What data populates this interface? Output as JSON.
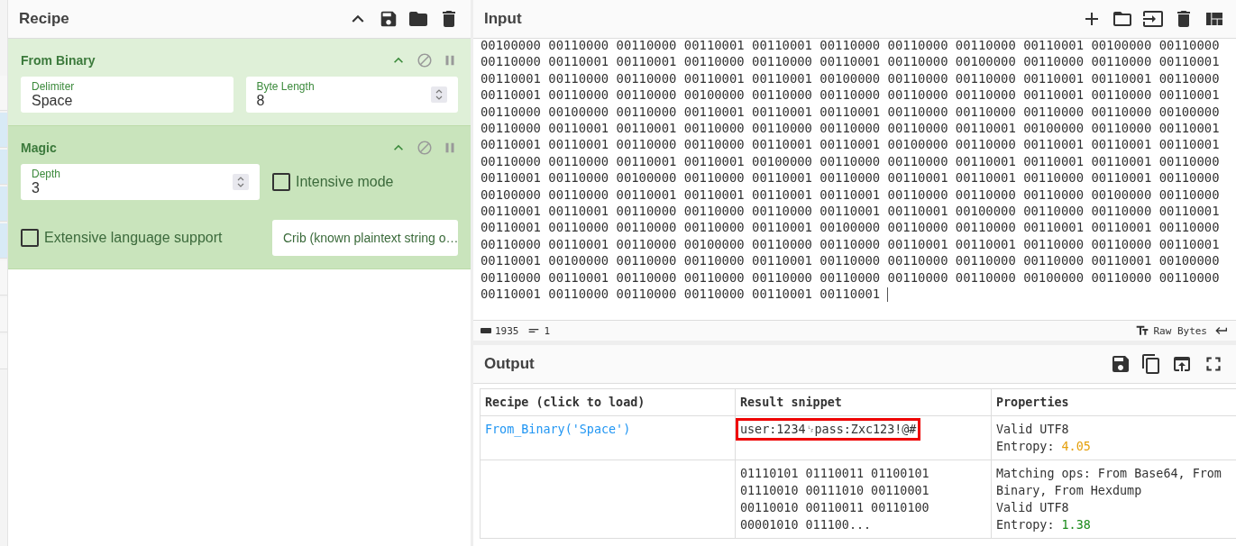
{
  "recipe": {
    "title": "Recipe",
    "operations": [
      {
        "name": "From Binary",
        "kind": "from_binary",
        "fields": [
          {
            "kind": "text",
            "label": "Delimiter",
            "value": "Space"
          },
          {
            "kind": "number",
            "label": "Byte Length",
            "value": "8"
          }
        ]
      },
      {
        "name": "Magic",
        "kind": "magic",
        "fields": [
          {
            "kind": "number",
            "label": "Depth",
            "value": "3"
          },
          {
            "kind": "checkbox",
            "label": "Intensive mode",
            "checked": false
          },
          {
            "kind": "checkbox",
            "label": "Extensive language support",
            "checked": false
          },
          {
            "kind": "text",
            "placeholder": "Crib (known plaintext string o…"
          }
        ]
      }
    ]
  },
  "input": {
    "title": "Input",
    "lines": [
      "00100000 00110000 00110000 00110001 00110001 00110000 00110000 00110000 00110001 00100000 00110000",
      "00110000 00110001 00110001 00110000 00110000 00110001 00110000 00100000 00110000 00110000 00110001",
      "00110001 00110000 00110000 00110001 00110001 00100000 00110000 00110000 00110001 00110001 00110000",
      "00110001 00110000 00110000 00100000 00110000 00110000 00110000 00110000 00110001 00110000 00110001",
      "00110000 00100000 00110000 00110001 00110001 00110001 00110000 00110000 00110000 00110000 00100000",
      "00110000 00110001 00110001 00110000 00110000 00110000 00110000 00110001 00100000 00110000 00110001",
      "00110001 00110001 00110000 00110000 00110001 00110001 00100000 00110000 00110001 00110001 00110001",
      "00110000 00110000 00110001 00110001 00100000 00110000 00110000 00110001 00110001 00110001 00110000",
      "00110001 00110000 00100000 00110000 00110001 00110000 00110001 00110001 00110000 00110001 00110000",
      "00100000 00110000 00110001 00110001 00110001 00110001 00110000 00110000 00110000 00100000 00110000",
      "00110001 00110001 00110000 00110000 00110000 00110001 00110001 00100000 00110000 00110000 00110001",
      "00110001 00110000 00110000 00110000 00110001 00100000 00110000 00110000 00110001 00110001 00110000",
      "00110000 00110001 00110000 00100000 00110000 00110000 00110001 00110001 00110000 00110000 00110001",
      "00110001 00100000 00110000 00110000 00110001 00110000 00110000 00110000 00110000 00110001 00100000",
      "00110000 00110001 00110000 00110000 00110000 00110000 00110000 00110000 00100000 00110000 00110000",
      "00110001 00110000 00110000 00110000 00110001 00110001"
    ],
    "status": {
      "length": "1935",
      "lines": "1",
      "format": "Raw Bytes"
    }
  },
  "output": {
    "title": "Output",
    "table": {
      "columns": [
        "Recipe (click to load)",
        "Result snippet",
        "Properties"
      ],
      "rows": [
        {
          "recipe": "From_Binary('Space')",
          "snippet": [
            "user:1234␊pass:Zxc123!@#"
          ],
          "highlighted": true,
          "properties": [
            "Valid UTF8"
          ],
          "entropy": {
            "label": "Entropy:",
            "value": "4.05",
            "color": "#e5a00d"
          }
        },
        {
          "snippet": [
            "01110101 01110011 01100101",
            "01110010 00111010 00110001",
            "00110010 00110011 00110100",
            "00001010 011100..."
          ],
          "highlighted": false,
          "properties": [
            "Matching ops: From Base64, From",
            "Binary, From Hexdump",
            "Valid UTF8"
          ],
          "entropy": {
            "label": "Entropy:",
            "value": "1.38",
            "color": "#1b8a1b"
          }
        }
      ]
    }
  }
}
